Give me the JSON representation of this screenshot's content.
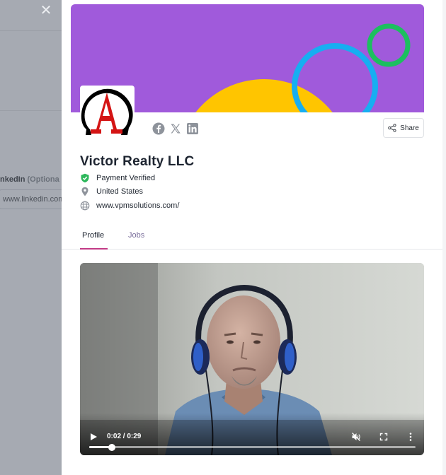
{
  "background": {
    "linkedin_label": "nkedIn",
    "linkedin_optional": "(Optiona",
    "linkedin_placeholder": "www.linkedin.com"
  },
  "drawer": {
    "share_label": "Share",
    "company_name": "Victor Realty LLC",
    "payment_status": "Payment Verified",
    "location": "United States",
    "website": "www.vpmsolutions.com/",
    "tabs": [
      {
        "label": "Profile",
        "active": true
      },
      {
        "label": "Jobs",
        "active": false
      }
    ],
    "social_icons": [
      "facebook-icon",
      "x-twitter-icon",
      "linkedin-icon"
    ],
    "video": {
      "time_display": "0:02 / 0:29",
      "current_seconds": 2,
      "duration_seconds": 29,
      "muted": true
    }
  },
  "colors": {
    "cover_bg": "#a05adb",
    "accent_tab": "#c23a86",
    "verified_green": "#2eb85c"
  }
}
